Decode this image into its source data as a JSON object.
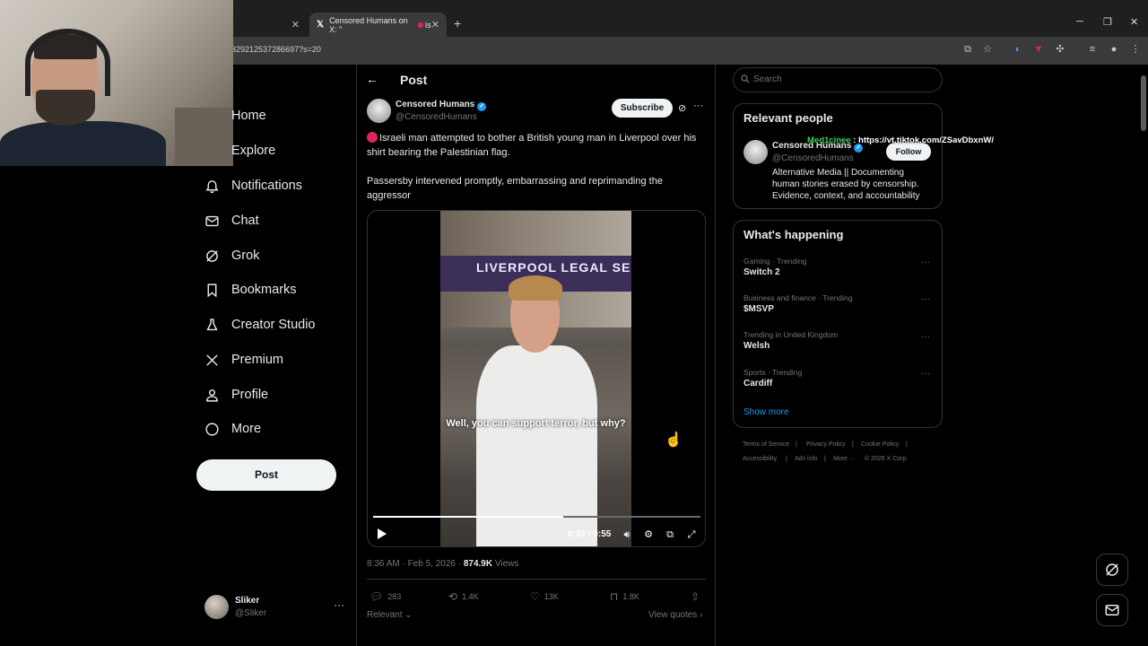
{
  "browser": {
    "tabs": [
      {
        "label": "",
        "active": false
      },
      {
        "label": "Censored Humans on X: \"",
        "suffix": "Is",
        "active": true
      }
    ],
    "new_tab": "+",
    "url": "329212537286697?s=20",
    "window_controls": {
      "minimize": "─",
      "restore": "❐",
      "close": "✕"
    }
  },
  "nav": {
    "items": [
      {
        "label": "Home",
        "icon": "home-icon"
      },
      {
        "label": "Explore",
        "icon": "search-icon"
      },
      {
        "label": "Notifications",
        "icon": "bell-icon"
      },
      {
        "label": "Chat",
        "icon": "mail-icon"
      },
      {
        "label": "Grok",
        "icon": "grok-icon"
      },
      {
        "label": "Bookmarks",
        "icon": "bookmark-icon"
      },
      {
        "label": "Creator Studio",
        "icon": "flask-icon"
      },
      {
        "label": "Premium",
        "icon": "x-logo-icon"
      },
      {
        "label": "Profile",
        "icon": "person-icon"
      },
      {
        "label": "More",
        "icon": "more-circle-icon"
      }
    ],
    "post_button": "Post",
    "account": {
      "name": "Sliker",
      "handle": "@Sliker",
      "more": "···"
    }
  },
  "post": {
    "header": "Post",
    "back": "←",
    "author": {
      "name": "Censored Humans",
      "handle": "@CensoredHumans",
      "verified": "✓"
    },
    "subscribe": "Subscribe",
    "more": "···",
    "text1": "Israeli man attempted to bother a British young man in Liverpool over his shirt bearing the Palestinian flag.",
    "text2": "Passersby intervened promptly, embarrassing and reprimanding the aggressor",
    "video": {
      "sign": "LIVERPOOL LEGAL SERVICES",
      "caption": "Well, you can support terror, but why?",
      "time": "0:32 / 0:55",
      "progress": 0.58
    },
    "meta": {
      "time": "8:36 AM · Feb 5, 2026 · ",
      "views_count": "874.9K",
      "views_label": " Views"
    },
    "actions": {
      "replies": "283",
      "reposts": "1.4K",
      "likes": "13K",
      "bookmarks": "1.8K"
    },
    "relevant": "Relevant ⌄",
    "view_quotes": "View quotes ›"
  },
  "sidebar": {
    "search_placeholder": "Search",
    "relevant_people": {
      "title": "Relevant people",
      "name": "Censored Humans",
      "handle": "@CensoredHumans",
      "follow": "Follow",
      "bio": "Alternative Media || Documenting human stories erased by censorship. Evidence, context, and accountability"
    },
    "overlay": {
      "name": "Med1cinee",
      "sep": " : ",
      "link": "https://vt.tiktok.com/ZSavDbxnW/"
    },
    "whats_happening": {
      "title": "What's happening",
      "trends": [
        {
          "category": "Gaming · Trending",
          "name": "Switch 2"
        },
        {
          "category": "Business and finance · Trending",
          "name": "$MSVP"
        },
        {
          "category": "Trending in United Kingdom",
          "name": "Welsh"
        },
        {
          "category": "Sports · Trending",
          "name": "Cardiff"
        }
      ],
      "show_more": "Show more"
    },
    "footer": [
      "Terms of Service",
      "Privacy Policy",
      "Cookie Policy",
      "Accessibility",
      "Ads info",
      "More ···",
      "© 2026 X Corp."
    ]
  },
  "colors": {
    "accent": "#1d9bf0",
    "background": "#000000",
    "border": "#2f3336",
    "muted": "#71767b"
  }
}
